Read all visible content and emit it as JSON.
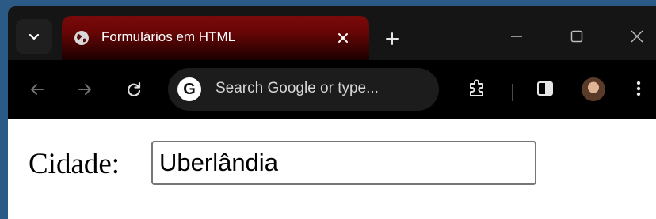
{
  "browser": {
    "tab": {
      "title": "Formulários em HTML"
    },
    "omnibox": {
      "placeholder": "Search Google or type..."
    }
  },
  "icons": {
    "tab_search": "chevron-down-icon",
    "favicon": "globe-icon",
    "tab_close": "close-icon",
    "new_tab": "plus-icon",
    "minimize": "minimize-icon",
    "maximize": "maximize-icon",
    "close_window": "close-icon",
    "back": "arrow-left-icon",
    "forward": "arrow-right-icon",
    "reload": "reload-icon",
    "google": "google-icon",
    "extensions": "puzzle-icon",
    "side_panel": "side-panel-icon",
    "menu": "kebab-menu-icon"
  },
  "colors": {
    "tab_active": "#6a0606",
    "window_bg": "#2b5a86",
    "toolbar_bg": "#000000"
  },
  "form": {
    "label": "Cidade:",
    "city_value": "Uberlândia"
  }
}
